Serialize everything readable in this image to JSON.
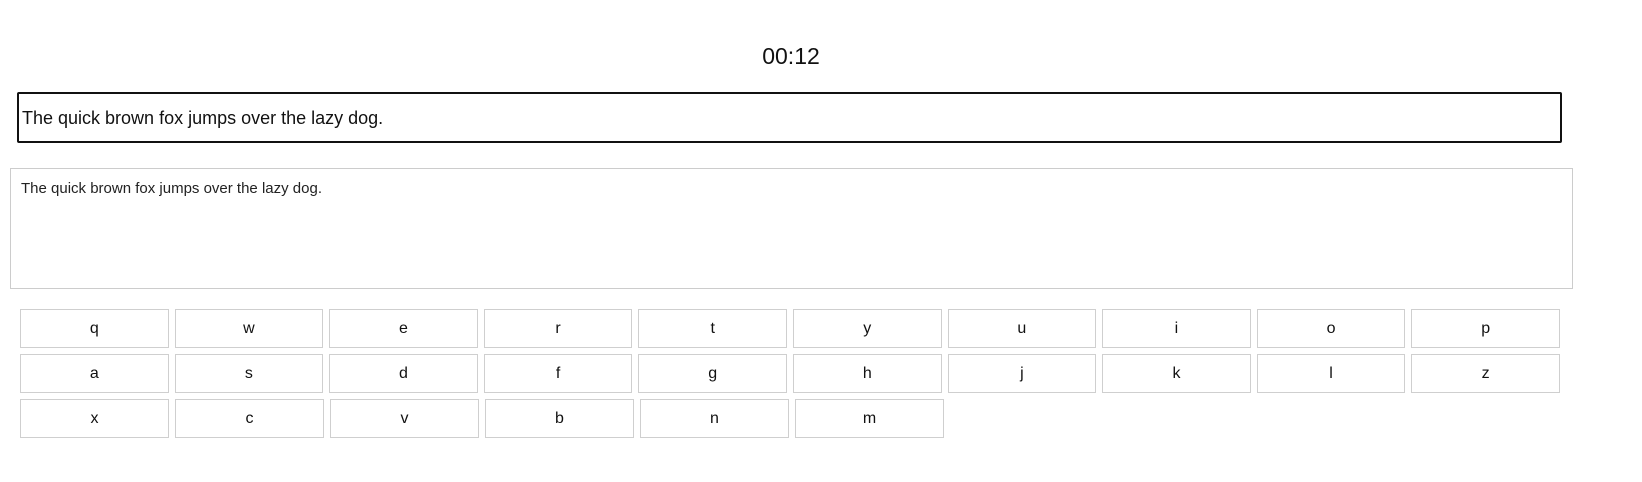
{
  "timer": "00:12",
  "target_text": "The quick brown fox jumps over the lazy dog.",
  "typing_area": {
    "value": "The quick brown fox jumps over the lazy dog."
  },
  "keyboard": {
    "rows": [
      [
        "q",
        "w",
        "e",
        "r",
        "t",
        "y",
        "u",
        "i",
        "o",
        "p"
      ],
      [
        "a",
        "s",
        "d",
        "f",
        "g",
        "h",
        "j",
        "k",
        "l",
        "z"
      ],
      [
        "x",
        "c",
        "v",
        "b",
        "n",
        "m"
      ]
    ]
  }
}
